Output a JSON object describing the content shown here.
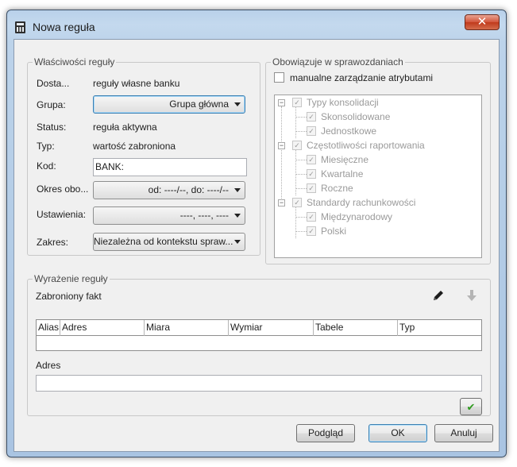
{
  "window": {
    "title": "Nowa reguła",
    "icon": "calculator-icon",
    "close_glyph": "✕"
  },
  "properties": {
    "legend": "Właściwości reguły",
    "provider": {
      "label": "Dosta...",
      "value": "reguły własne banku"
    },
    "group": {
      "label": "Grupa:",
      "value": "Grupa główna"
    },
    "status": {
      "label": "Status:",
      "value": "reguła aktywna"
    },
    "type": {
      "label": "Typ:",
      "value": "wartość zabroniona"
    },
    "code": {
      "label": "Kod:",
      "value": "BANK:"
    },
    "period": {
      "label": "Okres obo...",
      "value": "od: ----/--, do: ----/--"
    },
    "settings": {
      "label": "Ustawienia:",
      "value": "----, ----, ----"
    },
    "scope": {
      "label": "Zakres:",
      "value": "Niezależna od kontekstu spraw..."
    }
  },
  "reports": {
    "legend": "Obowiązuje w sprawozdaniach",
    "manual_checkbox": {
      "label": "manualne zarządzanie atrybutami",
      "checked": false
    },
    "tree": [
      {
        "label": "Typy konsolidacji",
        "children": [
          "Skonsolidowane",
          "Jednostkowe"
        ]
      },
      {
        "label": "Częstotliwości raportowania",
        "children": [
          "Miesięczne",
          "Kwartalne",
          "Roczne"
        ]
      },
      {
        "label": "Standardy rachunkowości",
        "children": [
          "Międzynarodowy",
          "Polski"
        ]
      }
    ],
    "check_glyph": "✓",
    "collapse_glyph": "−"
  },
  "expression": {
    "legend": "Wyrażenie reguły",
    "forbidden_fact": "Zabroniony fakt",
    "edit_icon": "pencil-icon",
    "down_icon": "arrow-down-icon",
    "columns": [
      "Alias",
      "Adres",
      "Miara",
      "Wymiar",
      "Tabele",
      "Typ"
    ],
    "address_label": "Adres",
    "address_value": "",
    "confirm_glyph": "✔"
  },
  "buttons": {
    "preview": "Podgląd",
    "ok": "OK",
    "cancel": "Anuluj"
  },
  "colors": {
    "close_button": "#c8452a",
    "confirm_check": "#2e9a1e",
    "disabled_text": "#9a9a9a"
  }
}
